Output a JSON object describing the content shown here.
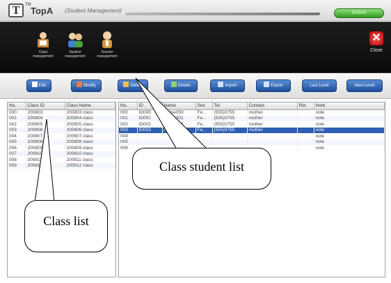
{
  "app": {
    "logo": "T",
    "trademark": "TM",
    "name": "TopA",
    "subtitle": "(Student Management)",
    "user_pill": "Online"
  },
  "modules": [
    {
      "label": "Class management",
      "icon": "class-management-icon"
    },
    {
      "label": "Student management",
      "icon": "student-management-icon"
    },
    {
      "label": "Teacher management",
      "icon": "teacher-management-icon"
    }
  ],
  "close": {
    "label": "Close",
    "icon": "close-icon"
  },
  "toolbar": [
    {
      "label": "Edit",
      "icon": "edit-icon"
    },
    {
      "label": "Modify",
      "icon": "modify-icon"
    },
    {
      "label": "Delete",
      "icon": "delete-icon"
    },
    {
      "label": "Details",
      "icon": "details-icon"
    },
    {
      "label": "Import",
      "icon": "import-icon"
    },
    {
      "label": "Export",
      "icon": "export-icon"
    },
    {
      "label": "Last Level",
      "icon": ""
    },
    {
      "label": "Next Level",
      "icon": ""
    }
  ],
  "class_list": {
    "headers": [
      "No.",
      "Class ID",
      "Class Name"
    ],
    "rows": [
      [
        "000",
        "200803",
        "200803 class"
      ],
      [
        "001",
        "200804",
        "200804 class"
      ],
      [
        "002",
        "200805",
        "200805 class"
      ],
      [
        "003",
        "200806",
        "200806 class"
      ],
      [
        "004",
        "200807",
        "200807 class"
      ],
      [
        "005",
        "200808",
        "200808 class"
      ],
      [
        "006",
        "200809",
        "200809 class"
      ],
      [
        "007",
        "200810",
        "200810 class"
      ],
      [
        "008",
        "200811",
        "200811 class"
      ],
      [
        "009",
        "200812",
        "200812 class"
      ]
    ]
  },
  "student_list": {
    "headers": [
      "No.",
      "ID",
      "Name",
      "Sex",
      "Tel",
      "Contact",
      "Rel.",
      "Note"
    ],
    "rows": [
      [
        "000",
        "ID000",
        "Name000",
        "Fe...",
        "(555)0755",
        "mother",
        "",
        "note"
      ],
      [
        "001",
        "ID001",
        "Name001",
        "Fe...",
        "(555)0755",
        "mother",
        "",
        "note"
      ],
      [
        "002",
        "ID002",
        "Name002",
        "Fe...",
        "(555)0755",
        "mother",
        "",
        "note"
      ],
      [
        "003",
        "ID003",
        "Name003",
        "Fe...",
        "(555)0755",
        "mother",
        "",
        "note"
      ],
      [
        "004",
        "",
        "",
        "",
        "",
        "",
        "",
        "note"
      ],
      [
        "005",
        "",
        "",
        "",
        "",
        "",
        "",
        "note"
      ],
      [
        "006",
        "",
        "",
        "",
        "",
        "",
        "",
        "note"
      ]
    ],
    "selected_index": 3
  },
  "annotations": {
    "class_list_label": "Class list",
    "student_list_label": "Class student list"
  }
}
